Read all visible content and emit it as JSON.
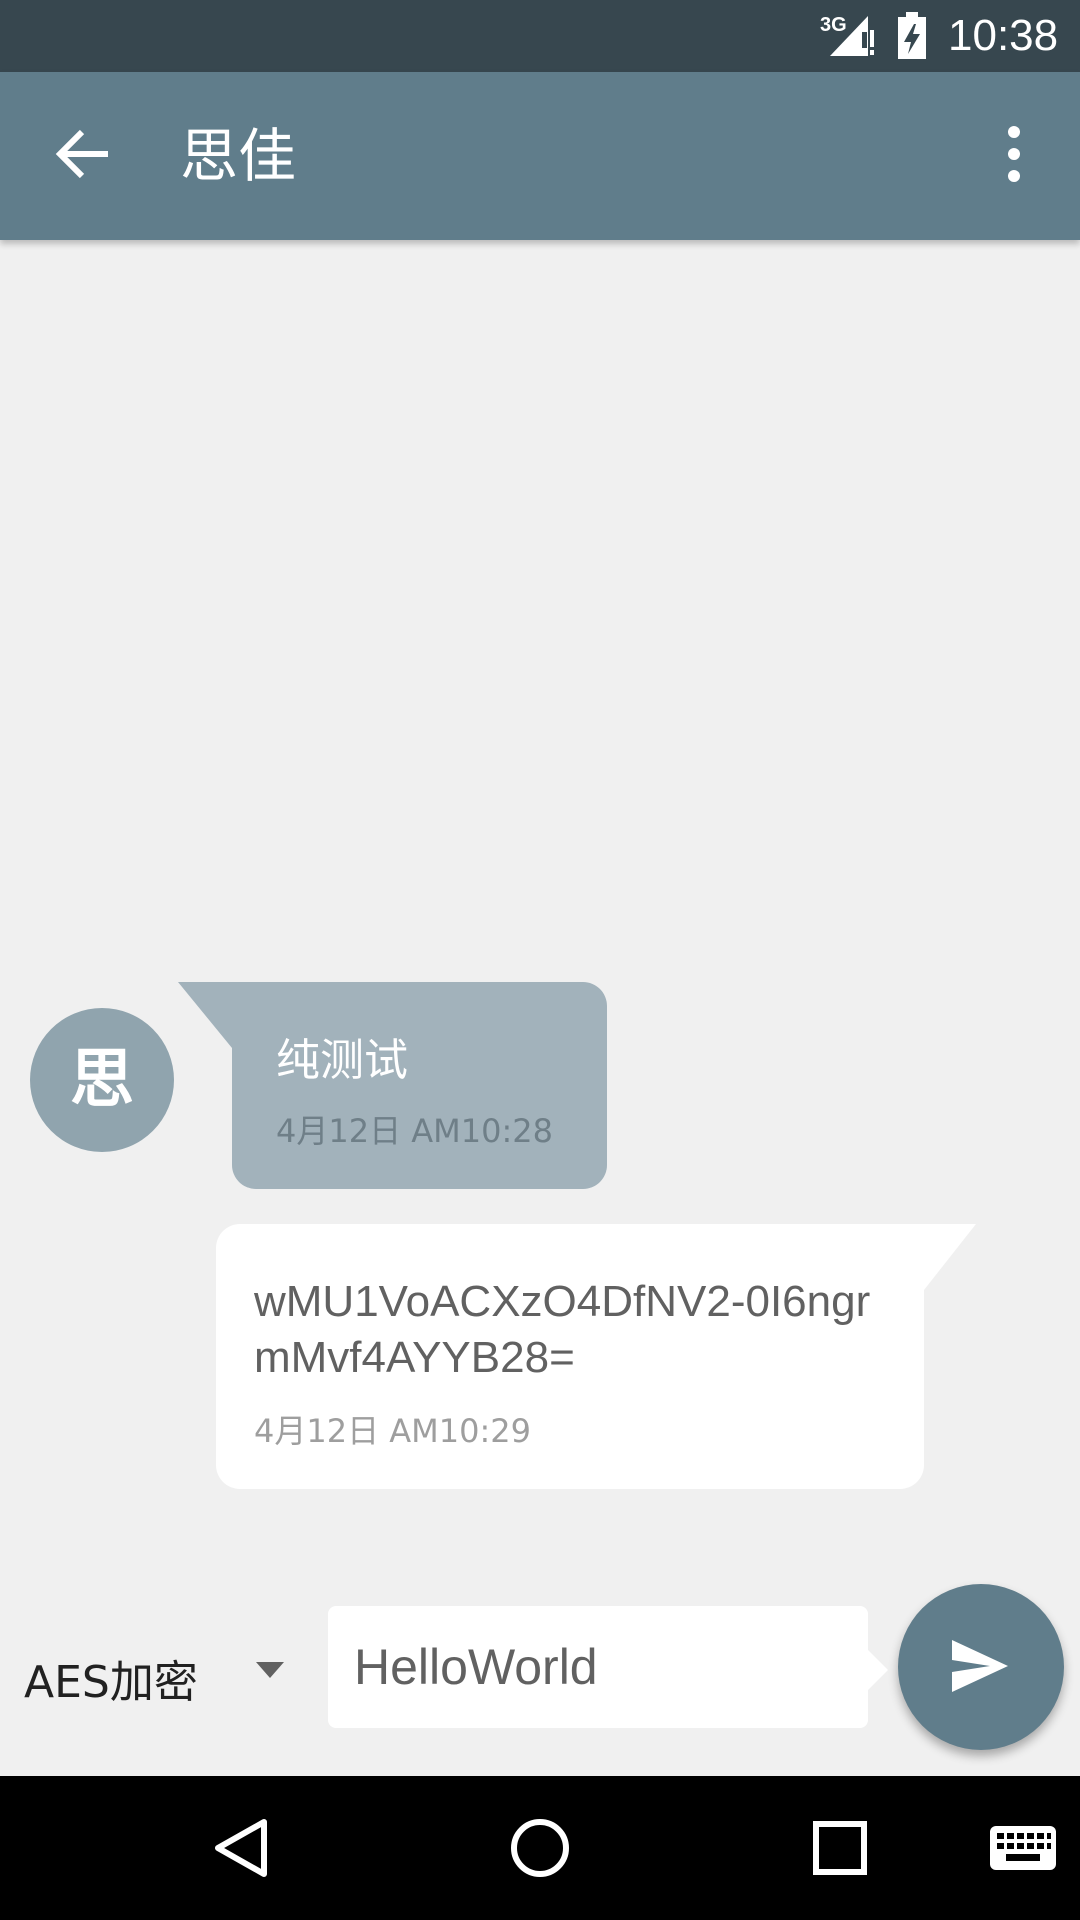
{
  "status_bar": {
    "network": "3G",
    "time": "10:38"
  },
  "app_bar": {
    "title": "思佳"
  },
  "contact": {
    "avatar_letter": "思"
  },
  "messages": [
    {
      "direction": "incoming",
      "text": "纯测试",
      "timestamp": "4月12日 AM10:28"
    },
    {
      "direction": "outgoing",
      "text": "wMU1VoACXzO4DfNV2-0I6ngrmMvf4AYYB28=",
      "timestamp": "4月12日 AM10:29"
    }
  ],
  "composer": {
    "encryption_mode": "AES加密",
    "input_value": "HelloWorld"
  },
  "icons": {
    "back": "back-arrow-icon",
    "more": "more-vert-icon",
    "dropdown": "dropdown-arrow-icon",
    "send": "send-icon",
    "nav_back": "nav-back-icon",
    "nav_home": "nav-home-icon",
    "nav_recents": "nav-recents-icon",
    "keyboard": "keyboard-icon"
  },
  "colors": {
    "status_bar": "#37474f",
    "app_bar": "#607d8b",
    "incoming_bubble": "#a2b2bb",
    "outgoing_bubble": "#ffffff",
    "background": "#f0f0f0"
  }
}
